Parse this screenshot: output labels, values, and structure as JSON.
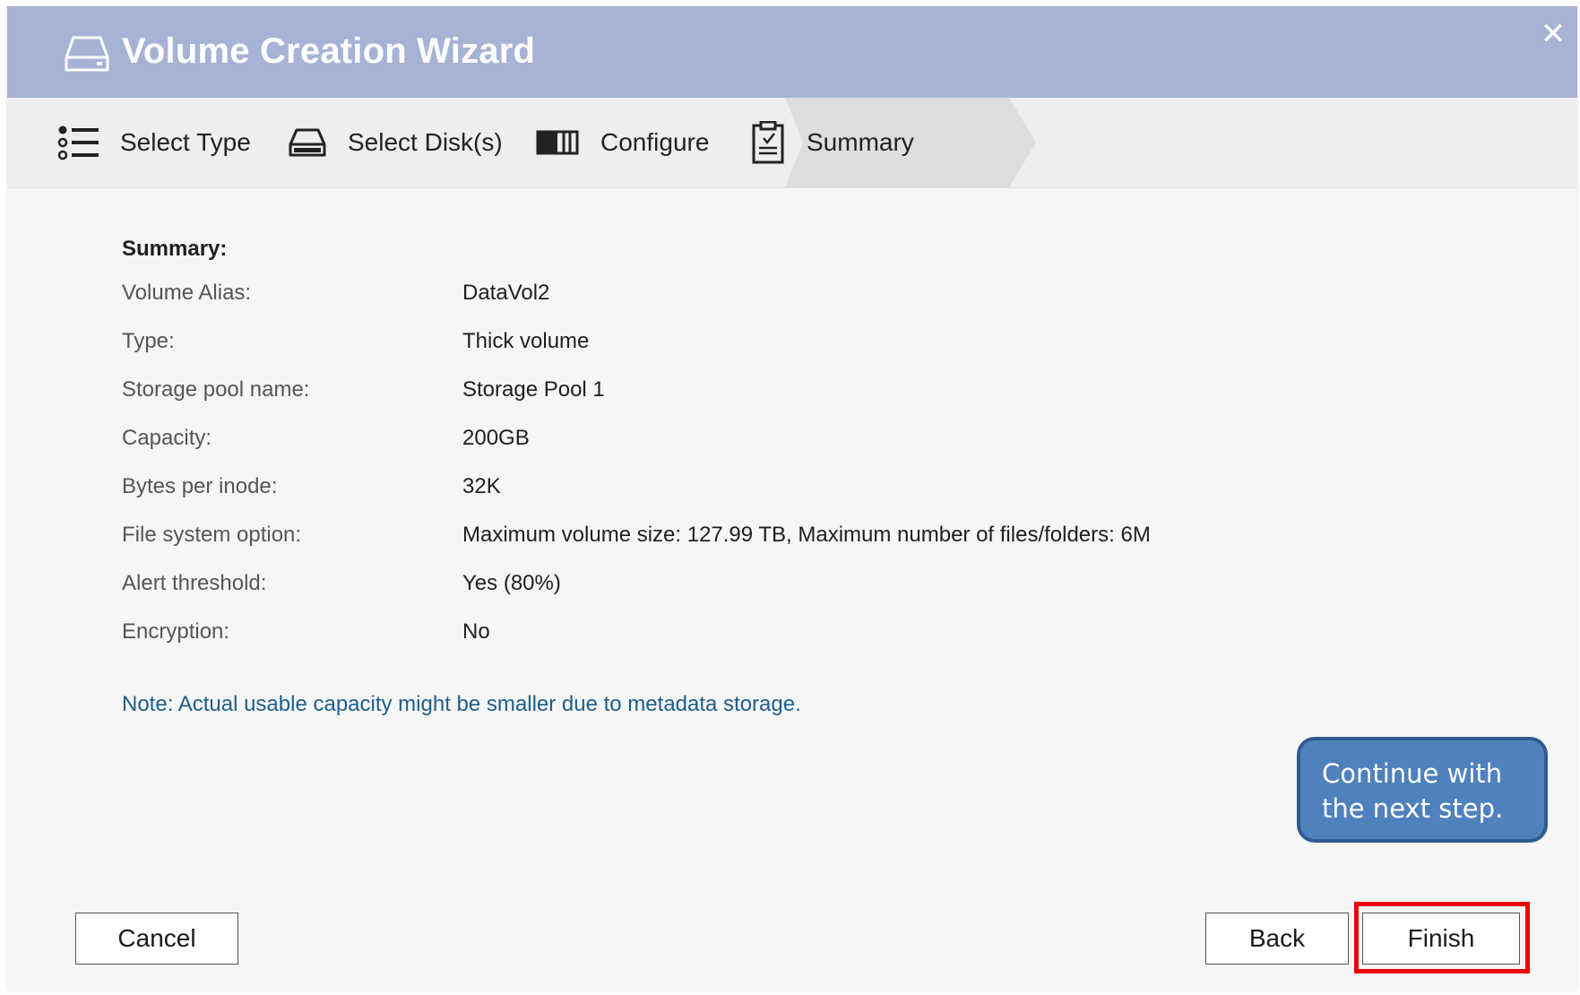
{
  "window": {
    "title": "Volume Creation Wizard",
    "close_symbol": "✕"
  },
  "steps": [
    {
      "label": "Select Type",
      "icon": "list-icon"
    },
    {
      "label": "Select Disk(s)",
      "icon": "disk-icon"
    },
    {
      "label": "Configure",
      "icon": "configure-icon"
    },
    {
      "label": "Summary",
      "icon": "clipboard-check-icon",
      "active": true
    }
  ],
  "summary": {
    "heading": "Summary:",
    "rows": [
      {
        "key": "Volume Alias:",
        "value": "DataVol2"
      },
      {
        "key": "Type:",
        "value": "Thick volume"
      },
      {
        "key": "Storage pool name:",
        "value": "Storage Pool 1"
      },
      {
        "key": "Capacity:",
        "value": "200GB"
      },
      {
        "key": "Bytes per inode:",
        "value": "32K"
      },
      {
        "key": "File system option:",
        "value": "Maximum volume size: 127.99 TB, Maximum number of files/folders: 6M"
      },
      {
        "key": "Alert threshold:",
        "value": "Yes (80%)"
      },
      {
        "key": "Encryption:",
        "value": "No"
      }
    ],
    "note": "Note: Actual usable capacity might be smaller due to metadata storage."
  },
  "callout": {
    "line1": "Continue with",
    "line2": "the next step."
  },
  "buttons": {
    "cancel": "Cancel",
    "back": "Back",
    "finish": "Finish"
  },
  "colors": {
    "titlebar": "#a6b3d5",
    "note_text": "#1d5e8c",
    "callout_fill": "#4f81bd",
    "highlight": "#ee0000"
  }
}
